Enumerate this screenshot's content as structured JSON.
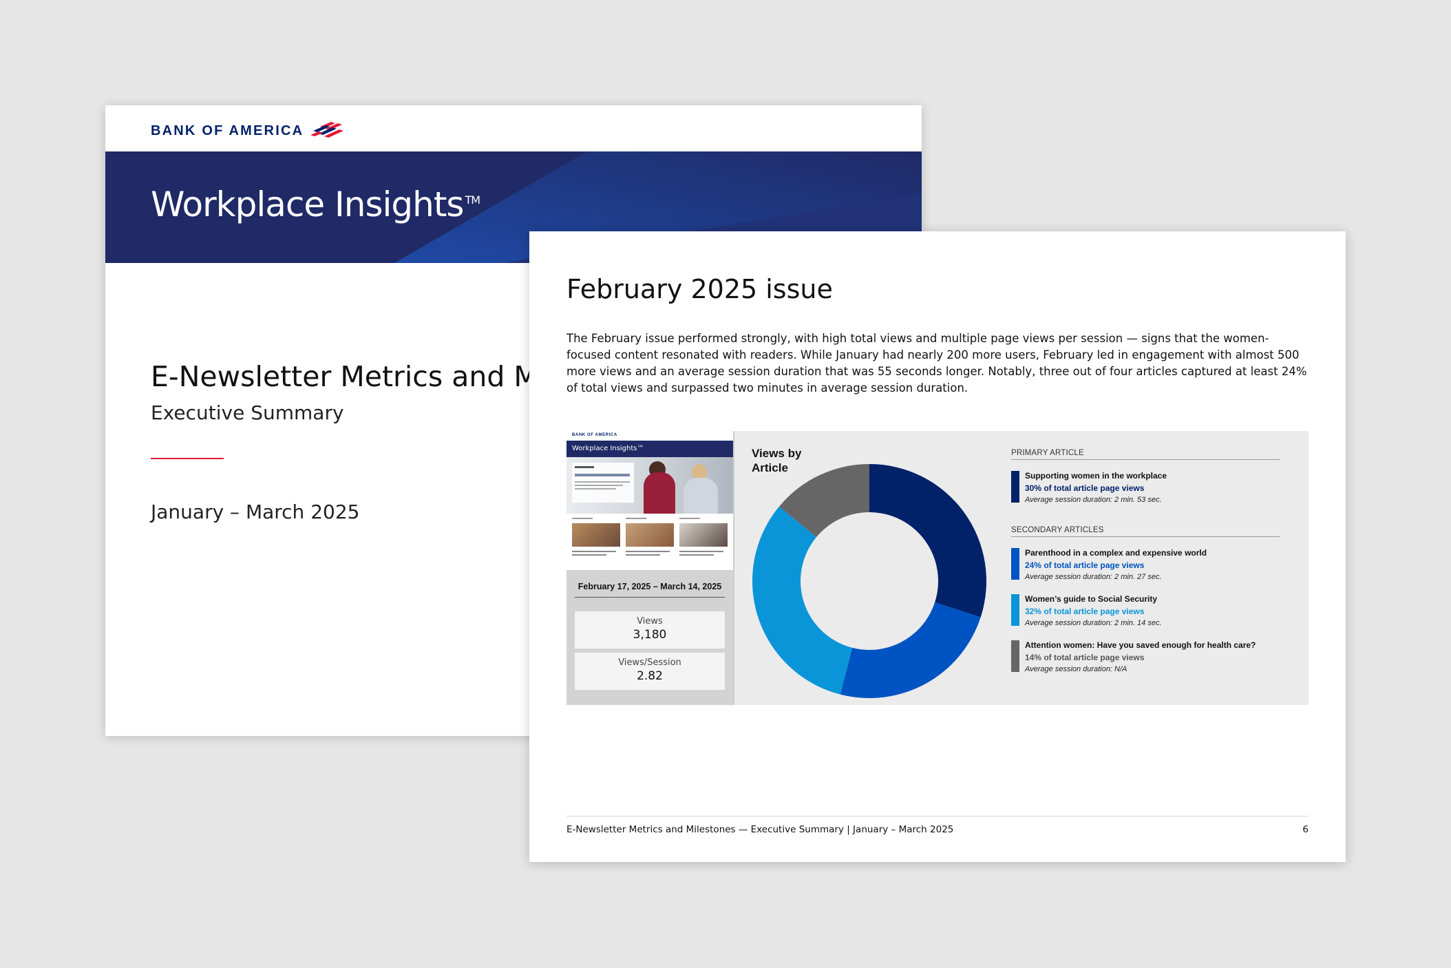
{
  "cover": {
    "logo_text": "BANK OF AMERICA",
    "brand": "Workplace Insights",
    "brand_mark": "TM",
    "title": "E-Newsletter Metrics and Milestones",
    "subtitle": "Executive Summary",
    "date_range": "January – March 2025",
    "colors": {
      "navy": "#1f2a66",
      "red": "#e31837",
      "logo_blue": "#012169"
    }
  },
  "page": {
    "title": "February 2025 issue",
    "intro": "The February issue performed strongly, with high total views and multiple page views per session — signs that the women-focused content resonated with readers. While January had nearly 200 more users, February led in engagement with almost 500 more views and an average session duration that was 55 seconds longer. Notably, three out of four articles captured at least 24% of total views and surpassed two minutes in average session duration.",
    "thumbnail": {
      "logo_text": "BANK OF AMERICA",
      "brand": "Workplace Insights™",
      "date_range": "February 17, 2025 – March 14, 2025",
      "stats": [
        {
          "label": "Views",
          "value": "3,180"
        },
        {
          "label": "Views/Session",
          "value": "2.82"
        }
      ]
    },
    "legend": {
      "primary_heading": "PRIMARY ARTICLE",
      "secondary_heading": "SECONDARY ARTICLES",
      "items": [
        {
          "name": "Supporting women in the workplace",
          "share": "30% of total article page views",
          "duration": "Average session duration: 2 min. 53 sec.",
          "color": "#012169",
          "share_color": "#012169"
        },
        {
          "name": "Parenthood in a complex and expensive world",
          "share": "24% of total article page views",
          "duration": "Average session duration: 2 min. 27 sec.",
          "color": "#0053c2",
          "share_color": "#0053c2"
        },
        {
          "name": "Women’s guide to Social Security",
          "share": "32% of total article page views",
          "duration": "Average session duration: 2 min. 14 sec.",
          "color": "#0a95d8",
          "share_color": "#0a95d8"
        },
        {
          "name": "Attention women: Have you saved enough for health care?",
          "share": "14% of total article page views",
          "duration": "Average session duration: N/A",
          "color": "#666666",
          "share_color": "#555555"
        }
      ]
    },
    "footer": {
      "text": "E-Newsletter Metrics and Milestones — Executive Summary  |  January – March 2025",
      "page_number": "6"
    }
  },
  "chart_data": {
    "type": "pie",
    "title": "Views by Article",
    "categories": [
      "Supporting women in the workplace",
      "Parenthood in a complex and expensive world",
      "Women’s guide to Social Security",
      "Attention women: Have you saved enough for health care?"
    ],
    "values": [
      30,
      24,
      32,
      14
    ],
    "colors": [
      "#012169",
      "#0053c2",
      "#0a95d8",
      "#666666"
    ],
    "donut": true,
    "legend": "right"
  }
}
